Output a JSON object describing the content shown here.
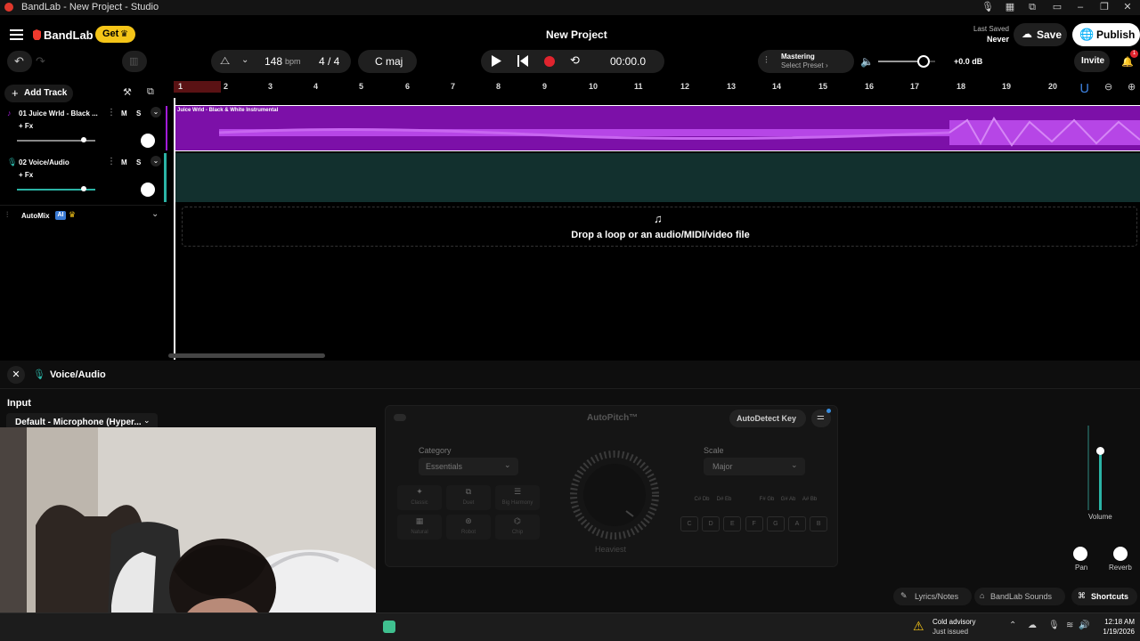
{
  "window": {
    "title": "BandLab - New Project - Studio"
  },
  "header": {
    "brand": "BandLab",
    "get_label": "Get",
    "project_title": "New Project",
    "last_saved_label": "Last Saved",
    "last_saved_value": "Never",
    "save_label": "Save",
    "publish_label": "Publish",
    "bpm_value": "148",
    "bpm_unit": "bpm",
    "time_signature": "4 / 4",
    "key": "C maj",
    "time_display": "00:00.0",
    "mastering_label": "Mastering",
    "mastering_preset": "Select Preset",
    "master_db": "+0.0 dB",
    "master_volume_level": 0.8,
    "invite_label": "Invite",
    "notification_count": "1"
  },
  "tracks_panel": {
    "add_track_label": "Add Track",
    "tracks": [
      {
        "name": "01  Juice Wrld - Black ...",
        "fx": "+ Fx",
        "m": "M",
        "s": "S",
        "color": "#a21bd9",
        "volume": 0.85
      },
      {
        "name": "02  Voice/Audio",
        "fx": "+ Fx",
        "m": "M",
        "s": "S",
        "color": "#2bb3a5",
        "volume": 0.85
      }
    ],
    "automix_label": "AutoMix",
    "automix_badge": "AI"
  },
  "timeline": {
    "ruler": [
      "1",
      "2",
      "3",
      "4",
      "5",
      "6",
      "7",
      "8",
      "9",
      "10",
      "11",
      "12",
      "13",
      "14",
      "15",
      "16",
      "17",
      "18",
      "19",
      "20"
    ],
    "clip_title": "Juice Wrld - Black & White Instrumental",
    "drop_text": "Drop a loop or an audio/MIDI/video file"
  },
  "bottom_panel": {
    "track_name": "Voice/Audio",
    "input_label": "Input",
    "input_device": "Default - Microphone (Hyper...",
    "autopitch_title": "AutoPitch™",
    "autodetect_label": "AutoDetect Key",
    "category_label": "Category",
    "category_value": "Essentials",
    "presets": [
      "Classic",
      "Duet",
      "Big Harmony",
      "Natural",
      "Robot",
      "Chip"
    ],
    "dial_label": "Heaviest",
    "scale_label": "Scale",
    "scale_value": "Major",
    "sharp_keys": [
      "C# Db",
      "D# Eb",
      "F# Gb",
      "G# Ab",
      "A# Bb"
    ],
    "natural_keys": [
      "C",
      "D",
      "E",
      "F",
      "G",
      "A",
      "B"
    ],
    "volume_label": "Volume",
    "pan_label": "Pan",
    "reverb_label": "Reverb",
    "lyrics_label": "Lyrics/Notes",
    "sounds_label": "BandLab Sounds",
    "shortcuts_label": "Shortcuts"
  },
  "taskbar": {
    "weather_title": "Cold advisory",
    "weather_sub": "Just issued",
    "time": "12:18 AM",
    "date": "1/19/2026"
  },
  "colors": {
    "accent_yellow": "#f5c518",
    "track1": "#a21bd9",
    "track2": "#1f5c57",
    "record": "#e0242e"
  }
}
